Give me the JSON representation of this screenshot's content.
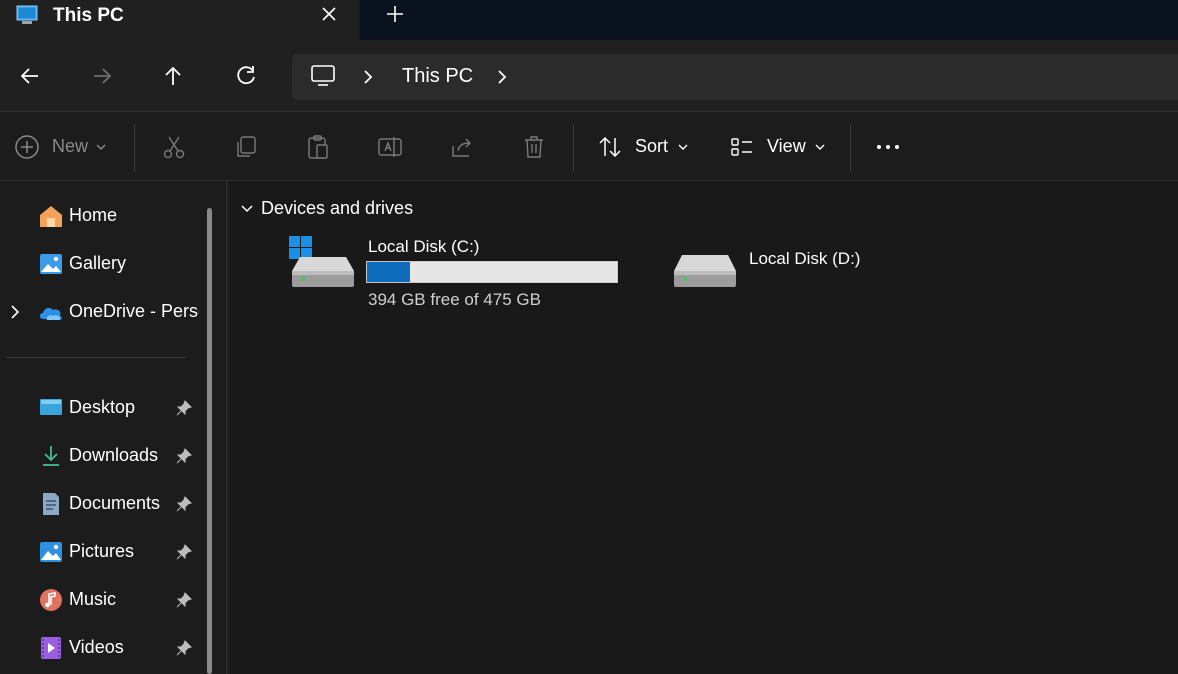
{
  "window": {
    "tab_title": "This PC",
    "tab_icon": "this-pc-icon",
    "close_icon": "close-icon",
    "new_tab_icon": "plus-icon"
  },
  "nav": {
    "back_icon": "arrow-left-icon",
    "forward_icon": "arrow-right-icon",
    "up_icon": "arrow-up-icon",
    "refresh_icon": "refresh-icon",
    "address_text": "This PC"
  },
  "commands": {
    "new_label": "New",
    "sort_label": "Sort",
    "view_label": "View",
    "icons": [
      "new-plus-icon",
      "cut-icon",
      "copy-icon",
      "paste-icon",
      "rename-icon",
      "share-icon",
      "delete-icon",
      "sort-icon",
      "view-icon",
      "more-icon"
    ]
  },
  "sidebar": {
    "top_items": [
      {
        "label": "Home",
        "icon": "home-icon"
      },
      {
        "label": "Gallery",
        "icon": "gallery-icon"
      },
      {
        "label": "OneDrive - Perso",
        "icon": "onedrive-icon"
      }
    ],
    "pinned_items": [
      {
        "label": "Desktop",
        "icon": "desktop-icon"
      },
      {
        "label": "Downloads",
        "icon": "downloads-icon"
      },
      {
        "label": "Documents",
        "icon": "documents-icon"
      },
      {
        "label": "Pictures",
        "icon": "pictures-icon"
      },
      {
        "label": "Music",
        "icon": "music-icon"
      },
      {
        "label": "Videos",
        "icon": "videos-icon"
      }
    ]
  },
  "main": {
    "group_title": "Devices and drives",
    "drives": [
      {
        "name": "Local Disk (C:)",
        "free_text": "394 GB free of 475 GB",
        "used_fraction": 0.17
      },
      {
        "name": "Local Disk (D:)"
      }
    ]
  },
  "colors": {
    "accent": "#0f6cbd",
    "background": "#191919",
    "sidebar": "#1c1c1c"
  }
}
